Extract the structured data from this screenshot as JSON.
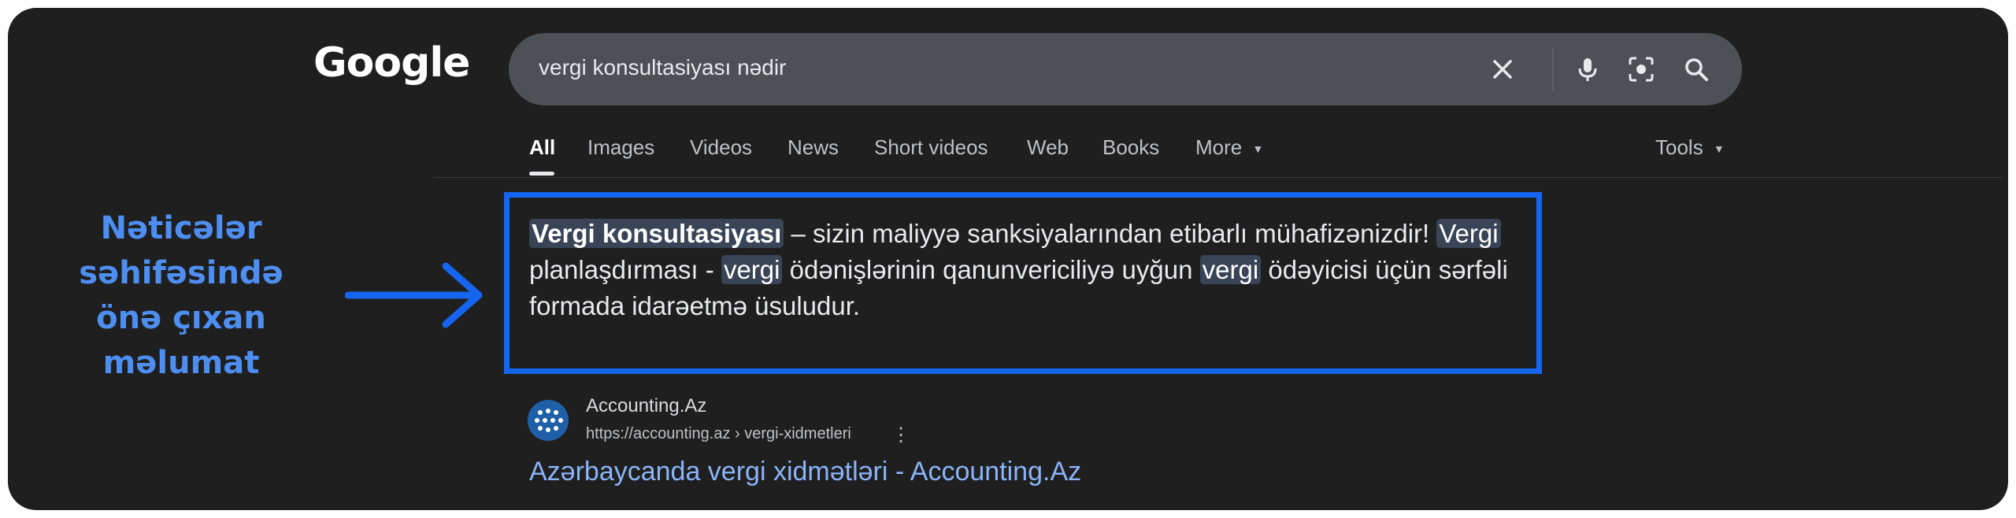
{
  "logo": "Google",
  "search": {
    "query": "vergi konsultasiyası nədir"
  },
  "tabs": [
    {
      "label": "All",
      "active": true
    },
    {
      "label": "Images"
    },
    {
      "label": "Videos"
    },
    {
      "label": "News"
    },
    {
      "label": "Short videos"
    },
    {
      "label": "Web"
    },
    {
      "label": "Books"
    },
    {
      "label": "More"
    }
  ],
  "tools": "Tools",
  "annotation": {
    "line1": "Nəticələr",
    "line2": "səhifəsində",
    "line3": "önə çıxan",
    "line4": "məlumat",
    "accent_color": "#1565f0"
  },
  "snippet": {
    "hl1": "Vergi konsultasiyası",
    "t1": " – sizin maliyyə sanksiyalarından etibarlı mühafizənizdir! ",
    "hl2": "Vergi",
    "t2": " planlaşdırması - ",
    "hl3": "vergi",
    "t3": " ödənişlərinin qanunvericiliyə uyğun ",
    "hl4": "vergi",
    "t4": " ödəyicisi üçün sərfəli formada idarəetmə üsuludur."
  },
  "result": {
    "site_name": "Accounting.Az",
    "url": "https://accounting.az › vergi-xidmetleri",
    "title": "Azərbaycanda vergi xidmətləri - Accounting.Az"
  }
}
